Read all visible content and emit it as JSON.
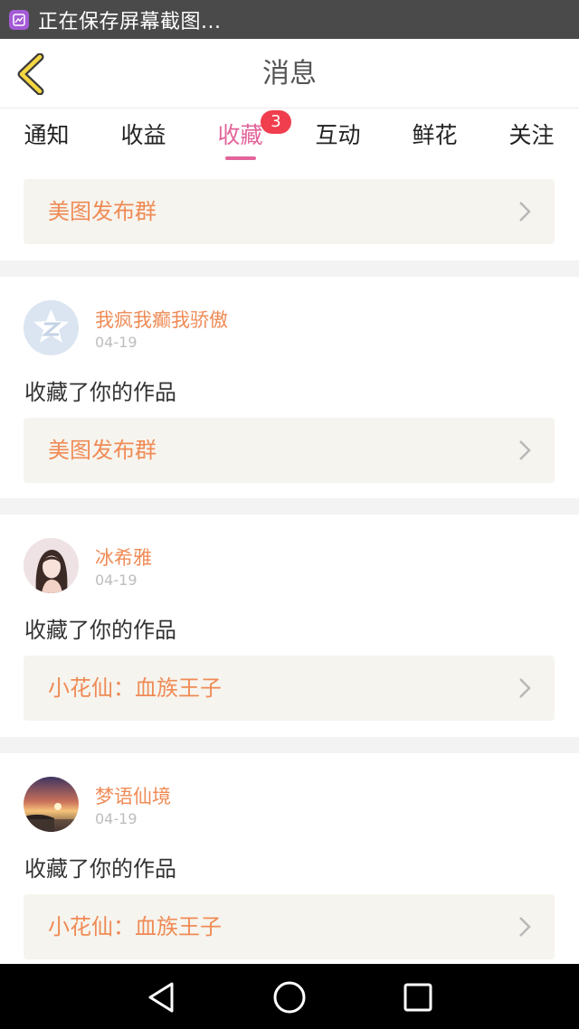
{
  "status_bar": {
    "text": "正在保存屏幕截图...",
    "icon": "screenshot-icon"
  },
  "header": {
    "title": "消息",
    "back_icon": "chevron-left-icon"
  },
  "tabs": [
    {
      "label": "通知",
      "active": false
    },
    {
      "label": "收益",
      "active": false
    },
    {
      "label": "收藏",
      "active": true,
      "badge": "3"
    },
    {
      "label": "互动",
      "active": false
    },
    {
      "label": "鲜花",
      "active": false
    },
    {
      "label": "关注",
      "active": false
    }
  ],
  "top_item": {
    "link": "美图发布群"
  },
  "messages": [
    {
      "username": "我疯我癫我骄傲",
      "date": "04-19",
      "action": "收藏了你的作品",
      "link": "美图发布群",
      "avatar": "default-qq-avatar"
    },
    {
      "username": "冰希雅",
      "date": "04-19",
      "action": "收藏了你的作品",
      "link": "小花仙：血族王子",
      "avatar": "girl-portrait-avatar"
    },
    {
      "username": "梦语仙境",
      "date": "04-19",
      "action": "收藏了你的作品",
      "link": "小花仙：血族王子",
      "avatar": "sunset-avatar"
    }
  ],
  "nav_bar": {
    "buttons": [
      "back-triangle-icon",
      "home-circle-icon",
      "recents-square-icon"
    ]
  },
  "colors": {
    "accent": "#e2649b",
    "link": "#ef8b56",
    "badge": "#f03e4e",
    "link_bg": "#f6f4ee"
  }
}
